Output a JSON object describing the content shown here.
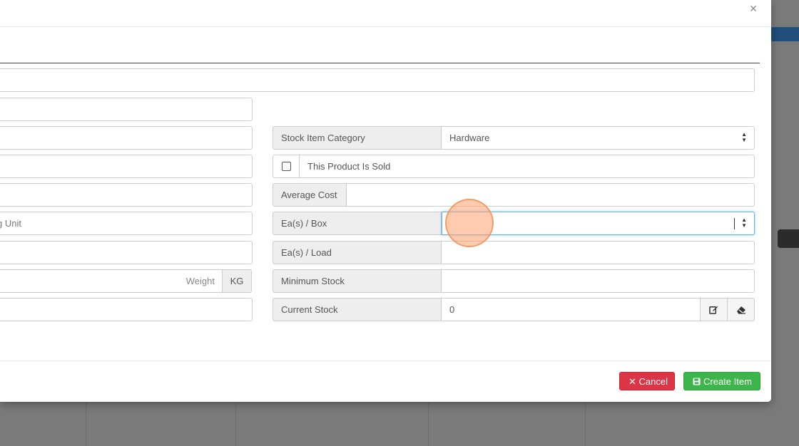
{
  "modal": {
    "close_label": "×",
    "footer": {
      "cancel_label": "✕ Cancel",
      "create_label": "Create Item"
    }
  },
  "left_fields": {
    "unit_placeholder": "g Unit",
    "weight_placeholder": "Weight",
    "weight_unit": "KG"
  },
  "right_fields": {
    "category_label": "Stock Item Category",
    "category_value": "Hardware",
    "sold_label": "This Product Is Sold",
    "average_cost_label": "Average Cost",
    "average_cost_value": "",
    "eas_box_label": "Ea(s) / Box",
    "eas_box_value": "",
    "eas_load_label": "Ea(s) / Load",
    "eas_load_value": "",
    "min_stock_label": "Minimum Stock",
    "min_stock_value": "",
    "current_stock_label": "Current Stock",
    "current_stock_value": "0"
  },
  "icons": {
    "close": "close-icon",
    "edit": "edit-icon",
    "eraser": "eraser-icon",
    "save": "save-icon",
    "select_arrows": "sort-arrows-icon"
  },
  "colors": {
    "cancel": "#dc3545",
    "create": "#3cb54a",
    "focus": "#66afe9",
    "tab_line": "#34495e"
  }
}
